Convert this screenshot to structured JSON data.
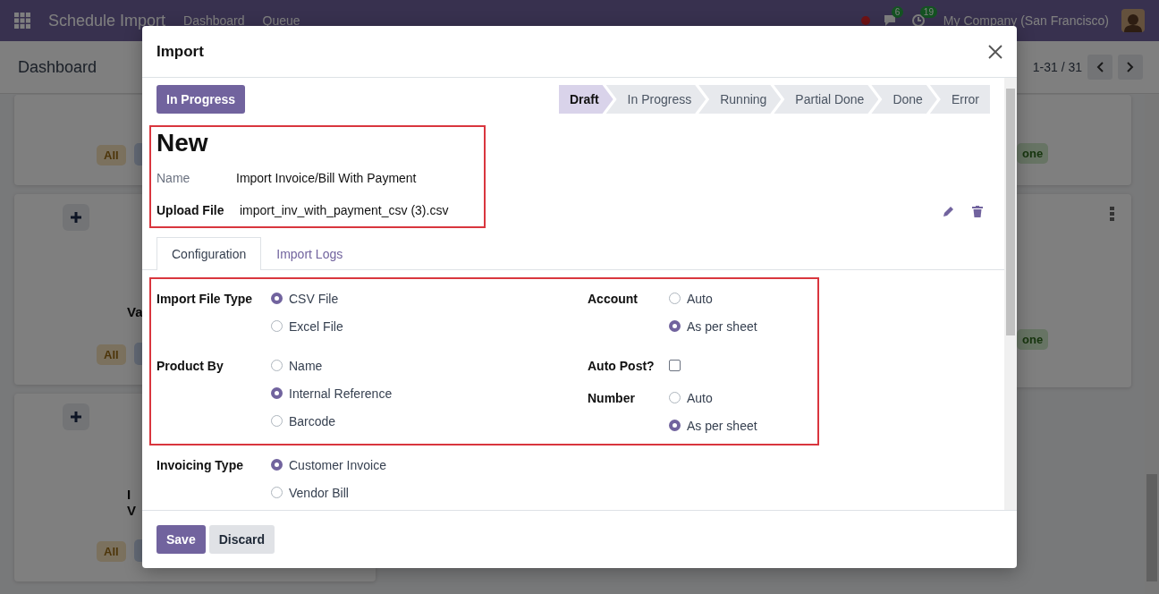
{
  "navbar": {
    "app_name": "Schedule Import",
    "menu": [
      "Dashboard",
      "Queue"
    ],
    "chat_count": "6",
    "activity_count": "19",
    "company": "My Company (San Francisco)"
  },
  "control_panel": {
    "title": "Dashboard",
    "pager": "1-31 / 31"
  },
  "kanban_left": [
    {
      "has_add_button": false,
      "tag": "All"
    },
    {
      "has_add_button": true,
      "title_lines": [
        "Va"
      ],
      "tag": "All"
    },
    {
      "has_add_button": true,
      "title_lines": [
        "I",
        "V"
      ],
      "tag": "All"
    }
  ],
  "kanban_right": [
    {
      "has_menu": false,
      "tag": "one"
    },
    {
      "has_menu": true,
      "tag": "one"
    }
  ],
  "dialog": {
    "title": "Import",
    "action_button": "In Progress",
    "stages": [
      {
        "label": "Draft",
        "selected": true
      },
      {
        "label": "In Progress",
        "selected": false
      },
      {
        "label": "Running",
        "selected": false
      },
      {
        "label": "Partial Done",
        "selected": false
      },
      {
        "label": "Done",
        "selected": false
      },
      {
        "label": "Error",
        "selected": false
      }
    ],
    "record_title": "New",
    "fields": [
      {
        "kind": "text",
        "label": "Name",
        "value": "Import Invoice/Bill With Payment"
      },
      {
        "kind": "file",
        "label": "Upload File",
        "value": "import_inv_with_payment_csv (3).csv"
      }
    ],
    "tabs": [
      {
        "label": "Configuration",
        "selected": true
      },
      {
        "label": "Import Logs",
        "selected": false
      }
    ],
    "config_left": [
      {
        "kind": "radio",
        "label": "Import File Type",
        "options": [
          {
            "label": "CSV File",
            "selected": true
          },
          {
            "label": "Excel File",
            "selected": false
          }
        ]
      },
      {
        "kind": "radio",
        "label": "Product By",
        "options": [
          {
            "label": "Name",
            "selected": false
          },
          {
            "label": "Internal Reference",
            "selected": true
          },
          {
            "label": "Barcode",
            "selected": false
          }
        ]
      }
    ],
    "config_right": [
      {
        "kind": "radio",
        "label": "Account",
        "options": [
          {
            "label": "Auto",
            "selected": false
          },
          {
            "label": "As per sheet",
            "selected": true
          }
        ]
      },
      {
        "kind": "checkbox",
        "label": "Auto Post?",
        "checked": false
      },
      {
        "kind": "radio",
        "label": "Number",
        "options": [
          {
            "label": "Auto",
            "selected": false
          },
          {
            "label": "As per sheet",
            "selected": true
          }
        ]
      }
    ],
    "invoicing": {
      "kind": "radio",
      "label": "Invoicing Type",
      "options": [
        {
          "label": "Customer Invoice",
          "selected": true
        },
        {
          "label": "Vendor Bill",
          "selected": false
        }
      ]
    },
    "buttons": {
      "save": "Save",
      "discard": "Discard"
    }
  }
}
